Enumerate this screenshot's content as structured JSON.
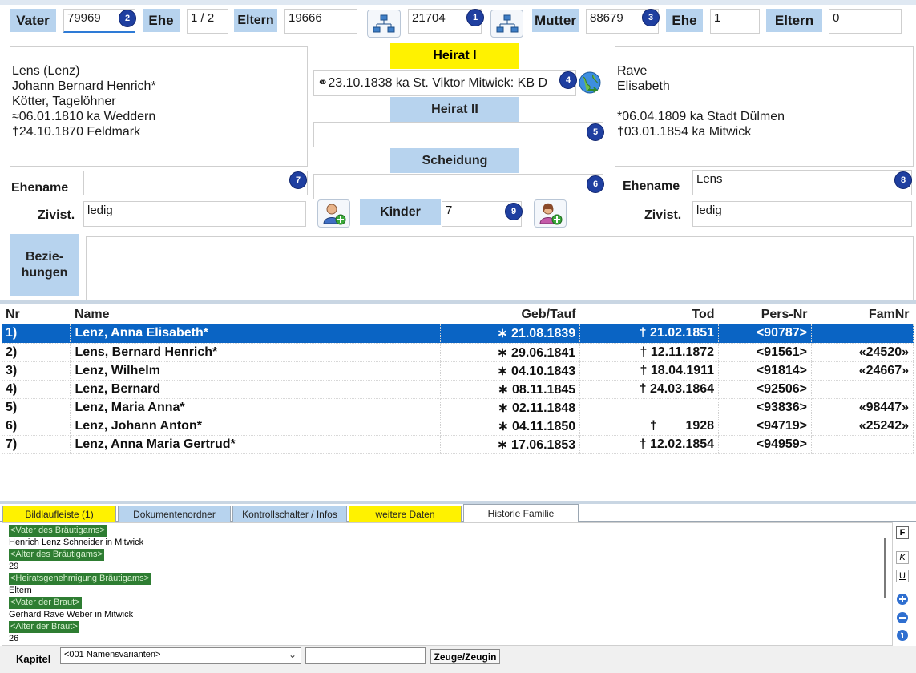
{
  "header": {
    "vater_label": "Vater",
    "vater_value": "79969",
    "ehe_label": "Ehe",
    "ehe_value_left": "1 / 2",
    "eltern_label": "Eltern",
    "eltern_value_left": "19666",
    "family_nr": "21704",
    "mutter_label": "Mutter",
    "mutter_value": "88679",
    "ehe_value_right": "1",
    "eltern_value_right": "0"
  },
  "badges": {
    "b1": "1",
    "b2": "2",
    "b3": "3",
    "b4": "4",
    "b5": "5",
    "b6": "6",
    "b7": "7",
    "b8": "8",
    "b9": "9"
  },
  "father": {
    "line1": "Lens (Lenz)",
    "line2": "Johann Bernard Henrich*",
    "line3": "Kötter, Tagelöhner",
    "line4": "≈06.01.1810 ka Weddern",
    "line5": "†24.10.1870 Feldmark"
  },
  "mother": {
    "line1": "Rave",
    "line2": "Elisabeth",
    "line3": "",
    "line4": "*06.04.1809 ka Stadt Dülmen",
    "line5": "†03.01.1854 ka Mitwick"
  },
  "marriage": {
    "heirat1_label": "Heirat I",
    "heirat1_value": "⚭23.10.1838 ka St. Viktor Mitwick: KB D",
    "heirat2_label": "Heirat II",
    "heirat2_value": "",
    "scheidung_label": "Scheidung",
    "scheidung_value": ""
  },
  "left_fields": {
    "ehename_label": "Ehename",
    "ehename_value": "",
    "zivist_label": "Zivist.",
    "zivist_value": "ledig"
  },
  "right_fields": {
    "ehename_label": "Ehename",
    "ehename_value": "Lens",
    "zivist_label": "Zivist.",
    "zivist_value": "ledig"
  },
  "kinder": {
    "label": "Kinder",
    "value": "7"
  },
  "beziehungen": {
    "label_line1": "Bezie-",
    "label_line2": "hungen",
    "value": ""
  },
  "children_table": {
    "headers": {
      "nr": "Nr",
      "name": "Name",
      "geb": "Geb/Tauf",
      "tod": "Tod",
      "pers": "Pers-Nr",
      "fam": "FamNr"
    },
    "rows": [
      {
        "nr": "1)",
        "name": "Lenz, Anna Elisabeth*",
        "geb": "∗ 21.08.1839",
        "tod": "† 21.02.1851",
        "pers": "<90787>",
        "fam": ""
      },
      {
        "nr": "2)",
        "name": "Lens, Bernard Henrich*",
        "geb": "∗ 29.06.1841",
        "tod": "† 12.11.1872",
        "pers": "<91561>",
        "fam": "«24520»"
      },
      {
        "nr": "3)",
        "name": "Lenz, Wilhelm",
        "geb": "∗ 04.10.1843",
        "tod": "† 18.04.1911",
        "pers": "<91814>",
        "fam": "«24667»"
      },
      {
        "nr": "4)",
        "name": "Lenz, Bernard",
        "geb": "∗ 08.11.1845",
        "tod": "† 24.03.1864",
        "pers": "<92506>",
        "fam": ""
      },
      {
        "nr": "5)",
        "name": "Lenz, Maria Anna*",
        "geb": "∗ 02.11.1848",
        "tod": "",
        "pers": "<93836>",
        "fam": "«98447»"
      },
      {
        "nr": "6)",
        "name": "Lenz, Johann Anton*",
        "geb": "∗ 04.11.1850",
        "tod": "†        1928",
        "pers": "<94719>",
        "fam": "«25242»"
      },
      {
        "nr": "7)",
        "name": "Lenz, Anna Maria Gertrud*",
        "geb": "∗ 17.06.1853",
        "tod": "† 12.02.1854",
        "pers": "<94959>",
        "fam": ""
      }
    ]
  },
  "tabs": [
    "Bildlaufleiste (1)",
    "Dokumentenordner",
    "Kontrollschalter / Infos",
    "weitere Daten",
    "Historie Familie"
  ],
  "notes": [
    {
      "tag": "<Vater des Bräutigams>",
      "text": "Henrich Lenz Schneider in Mitwick"
    },
    {
      "tag": "<Alter des Bräutigams>",
      "text": "29"
    },
    {
      "tag": "<Heiratsgenehmigung Bräutigams>",
      "text": "Eltern"
    },
    {
      "tag": "<Vater der Braut>",
      "text": "Gerhard Rave Weber in Mitwick"
    },
    {
      "tag": "<Alter der Braut>",
      "text": "26"
    }
  ],
  "format_buttons": {
    "bold": "F",
    "italic": "K",
    "underline": "U"
  },
  "footer": {
    "kapitel_label": "Kapitel",
    "kapitel_value": "<001 Namensvarianten>",
    "search_value": "",
    "zeuge_button": "Zeuge/Zeugin"
  },
  "colors": {
    "label_bg": "#b7d3ee",
    "heirat_bg": "#fff200",
    "selection": "#0a64c4",
    "tag_bg": "#2e7d32",
    "badge": "#1f3fa0"
  }
}
